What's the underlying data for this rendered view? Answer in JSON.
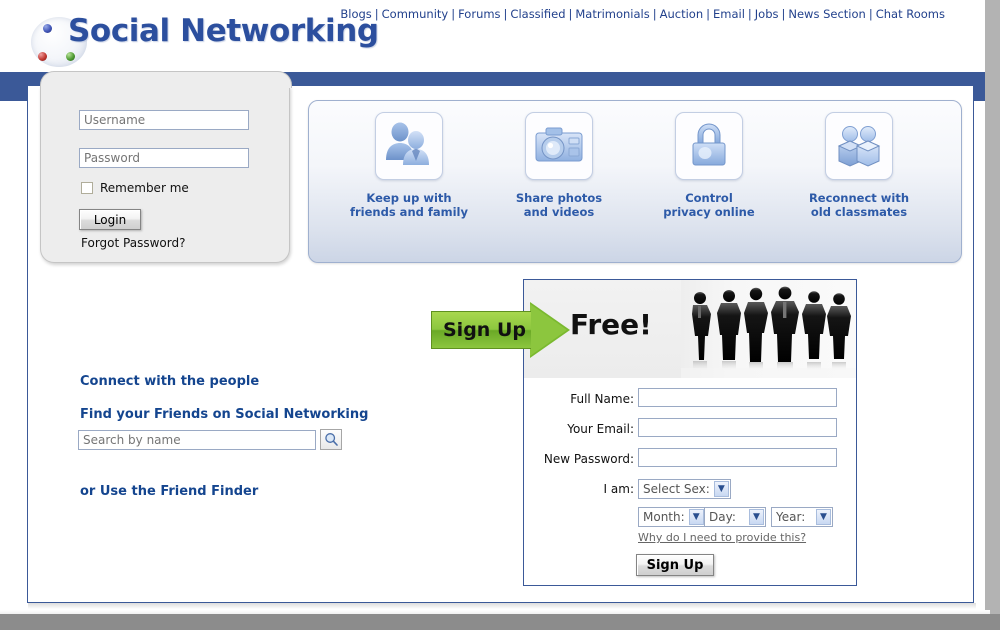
{
  "site": {
    "logo_text": "Social Networking",
    "logo_dots": [
      "blue-dot",
      "red-dot",
      "green-dot"
    ]
  },
  "topnav": {
    "items": [
      {
        "label": "Blogs"
      },
      {
        "label": "Community"
      },
      {
        "label": "Forums"
      },
      {
        "label": "Classified"
      },
      {
        "label": "Matrimonials"
      },
      {
        "label": "Auction"
      },
      {
        "label": "Email"
      },
      {
        "label": "Jobs"
      },
      {
        "label": "News Section"
      },
      {
        "label": "Chat Rooms"
      }
    ],
    "separator": "|"
  },
  "login": {
    "username_placeholder": "Username",
    "username_value": "",
    "password_placeholder": "Password",
    "password_value": "",
    "remember_label": "Remember me",
    "remember_checked": false,
    "login_button": "Login",
    "forgot_link": "Forgot Password?"
  },
  "features": [
    {
      "icon": "people-pair-icon",
      "line1": "Keep up with",
      "line2": "friends and family"
    },
    {
      "icon": "camera-icon",
      "line1": "Share photos",
      "line2": "and videos"
    },
    {
      "icon": "padlock-icon",
      "line1": "Control",
      "line2": "privacy online"
    },
    {
      "icon": "two-people-boxes-icon",
      "line1": "Reconnect with",
      "line2": "old classmates"
    }
  ],
  "promo": {
    "arrow_label": "Sign Up",
    "free_label": "Free!",
    "silhouette_count": 6,
    "arrow_color": "#8cc63e"
  },
  "signup_form": {
    "fields": [
      {
        "label": "Full Name:",
        "value": "",
        "name": "full-name"
      },
      {
        "label": "Your Email:",
        "value": "",
        "name": "email"
      },
      {
        "label": "New Password:",
        "value": "",
        "name": "new-password"
      }
    ],
    "sex_label": "I am:",
    "sex_select": "Select Sex:",
    "month_select": "Month:",
    "day_select": "Day:",
    "year_select": "Year:",
    "why_link": "Why do I need to provide this?",
    "submit_button": "Sign Up"
  },
  "left_content": {
    "heading1": "Connect with the people",
    "heading2": "Find your Friends on Social Networking",
    "search_placeholder": "Search by name",
    "search_value": "",
    "search_icon": "magnifier-icon",
    "heading3": "or Use the Friend Finder"
  },
  "colors": {
    "brand_blue": "#3b5998",
    "link_blue": "#22418c",
    "heading_blue": "#14458f",
    "accent_green": "#8cc63e",
    "panel_grey": "#ededed"
  },
  "watermark": {
    "text": ""
  }
}
